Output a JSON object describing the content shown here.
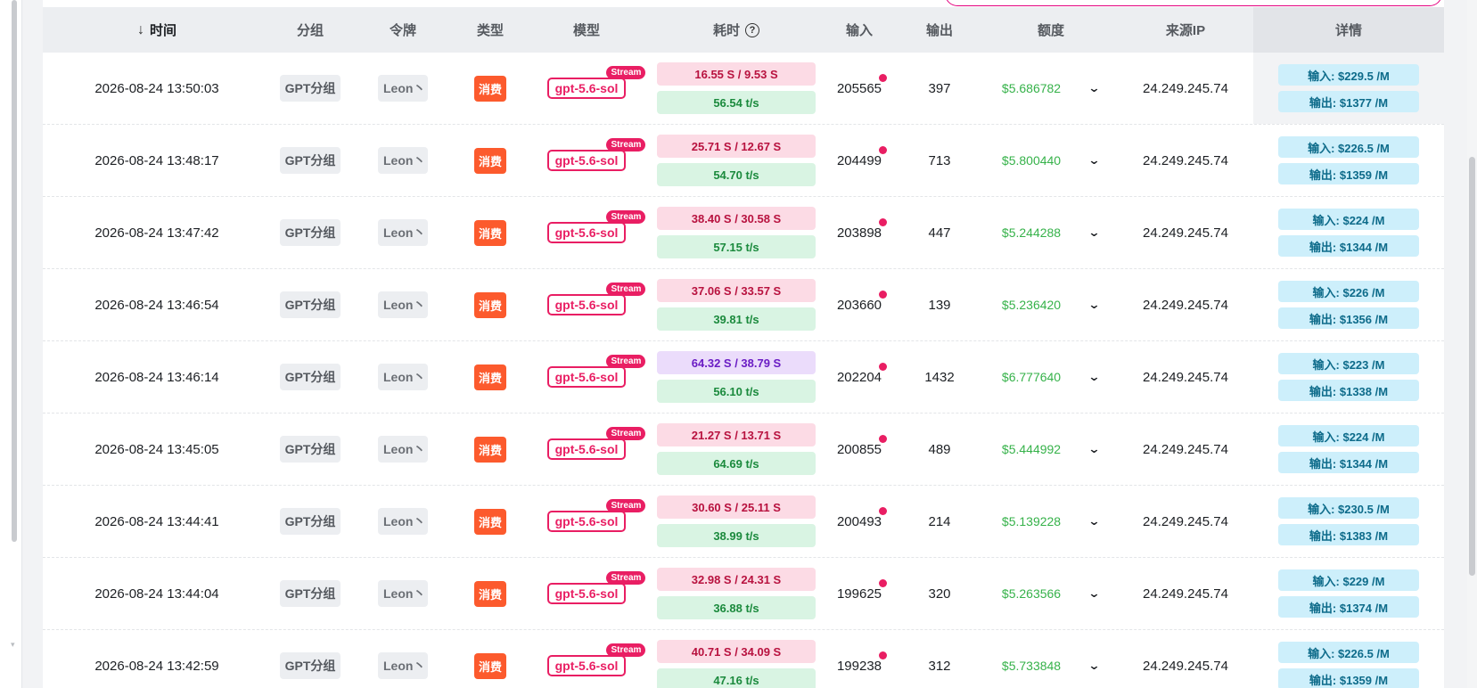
{
  "headers": {
    "time": "时间",
    "group": "分组",
    "token": "令牌",
    "type": "类型",
    "model": "模型",
    "duration": "耗时",
    "input": "输入",
    "output": "输出",
    "quota": "额度",
    "source_ip": "来源IP",
    "details": "详情"
  },
  "icons": {
    "sort": "arrow-down-icon",
    "help": "question-circle-icon",
    "expand": "chevron-down-icon"
  },
  "colors": {
    "consume_tag": "#fc5a2d",
    "model_accent": "#e91e63",
    "quota_green": "#36b24a",
    "detail_bg": "#cdeffb"
  },
  "rows": [
    {
      "time": "2026-08-24 13:50:03",
      "group": "GPT分组",
      "token": "Leon丶",
      "type": "消费",
      "model": "gpt-5.6-sol",
      "stream": "Stream",
      "duration": "16.55 S / 9.53 S",
      "duration_tone": "pink",
      "speed": "56.54 t/s",
      "input": "205565",
      "output": "397",
      "quota": "$5.686782",
      "ip": "24.249.245.74",
      "detail_in": "输入: $229.5 /M",
      "detail_out": "输出: $1377 /M"
    },
    {
      "time": "2026-08-24 13:48:17",
      "group": "GPT分组",
      "token": "Leon丶",
      "type": "消费",
      "model": "gpt-5.6-sol",
      "stream": "Stream",
      "duration": "25.71 S / 12.67 S",
      "duration_tone": "pink",
      "speed": "54.70 t/s",
      "input": "204499",
      "output": "713",
      "quota": "$5.800440",
      "ip": "24.249.245.74",
      "detail_in": "输入: $226.5 /M",
      "detail_out": "输出: $1359 /M"
    },
    {
      "time": "2026-08-24 13:47:42",
      "group": "GPT分组",
      "token": "Leon丶",
      "type": "消费",
      "model": "gpt-5.6-sol",
      "stream": "Stream",
      "duration": "38.40 S / 30.58 S",
      "duration_tone": "pink",
      "speed": "57.15 t/s",
      "input": "203898",
      "output": "447",
      "quota": "$5.244288",
      "ip": "24.249.245.74",
      "detail_in": "输入: $224 /M",
      "detail_out": "输出: $1344 /M"
    },
    {
      "time": "2026-08-24 13:46:54",
      "group": "GPT分组",
      "token": "Leon丶",
      "type": "消费",
      "model": "gpt-5.6-sol",
      "stream": "Stream",
      "duration": "37.06 S / 33.57 S",
      "duration_tone": "pink",
      "speed": "39.81 t/s",
      "input": "203660",
      "output": "139",
      "quota": "$5.236420",
      "ip": "24.249.245.74",
      "detail_in": "输入: $226 /M",
      "detail_out": "输出: $1356 /M"
    },
    {
      "time": "2026-08-24 13:46:14",
      "group": "GPT分组",
      "token": "Leon丶",
      "type": "消费",
      "model": "gpt-5.6-sol",
      "stream": "Stream",
      "duration": "64.32 S / 38.79 S",
      "duration_tone": "purple",
      "speed": "56.10 t/s",
      "input": "202204",
      "output": "1432",
      "quota": "$6.777640",
      "ip": "24.249.245.74",
      "detail_in": "输入: $223 /M",
      "detail_out": "输出: $1338 /M"
    },
    {
      "time": "2026-08-24 13:45:05",
      "group": "GPT分组",
      "token": "Leon丶",
      "type": "消费",
      "model": "gpt-5.6-sol",
      "stream": "Stream",
      "duration": "21.27 S / 13.71 S",
      "duration_tone": "pink",
      "speed": "64.69 t/s",
      "input": "200855",
      "output": "489",
      "quota": "$5.444992",
      "ip": "24.249.245.74",
      "detail_in": "输入: $224 /M",
      "detail_out": "输出: $1344 /M"
    },
    {
      "time": "2026-08-24 13:44:41",
      "group": "GPT分组",
      "token": "Leon丶",
      "type": "消费",
      "model": "gpt-5.6-sol",
      "stream": "Stream",
      "duration": "30.60 S / 25.11 S",
      "duration_tone": "pink",
      "speed": "38.99 t/s",
      "input": "200493",
      "output": "214",
      "quota": "$5.139228",
      "ip": "24.249.245.74",
      "detail_in": "输入: $230.5 /M",
      "detail_out": "输出: $1383 /M"
    },
    {
      "time": "2026-08-24 13:44:04",
      "group": "GPT分组",
      "token": "Leon丶",
      "type": "消费",
      "model": "gpt-5.6-sol",
      "stream": "Stream",
      "duration": "32.98 S / 24.31 S",
      "duration_tone": "pink",
      "speed": "36.88 t/s",
      "input": "199625",
      "output": "320",
      "quota": "$5.263566",
      "ip": "24.249.245.74",
      "detail_in": "输入: $229 /M",
      "detail_out": "输出: $1374 /M"
    },
    {
      "time": "2026-08-24 13:42:59",
      "group": "GPT分组",
      "token": "Leon丶",
      "type": "消费",
      "model": "gpt-5.6-sol",
      "stream": "Stream",
      "duration": "40.71 S / 34.09 S",
      "duration_tone": "pink",
      "speed": "47.16 t/s",
      "input": "199238",
      "output": "312",
      "quota": "$5.733848",
      "ip": "24.249.245.74",
      "detail_in": "输入: $226.5 /M",
      "detail_out": "输出: $1359 /M"
    }
  ]
}
